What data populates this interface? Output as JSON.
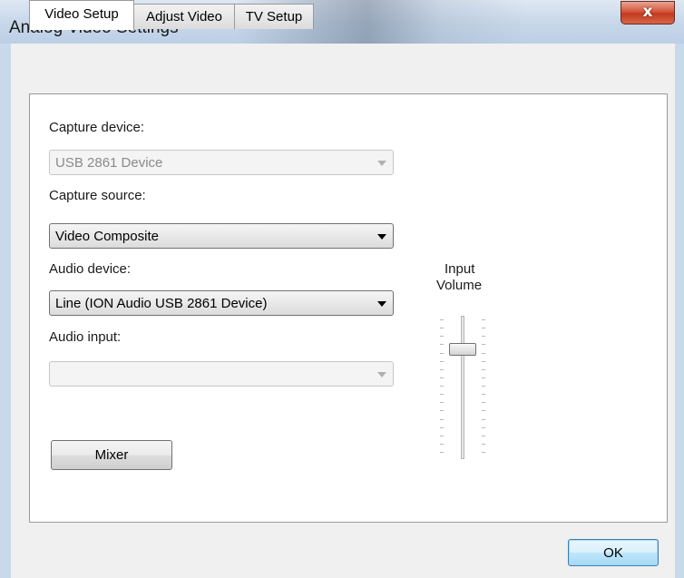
{
  "window": {
    "title": "Analog Video Settings",
    "close_label": "x"
  },
  "tabs": [
    {
      "label": "Video Setup",
      "active": true
    },
    {
      "label": "Adjust Video",
      "active": false
    },
    {
      "label": "TV Setup",
      "active": false
    }
  ],
  "video_setup": {
    "capture_device": {
      "label": "Capture device:",
      "value": "USB 2861 Device",
      "enabled": false
    },
    "capture_source": {
      "label": "Capture source:",
      "value": "Video Composite",
      "enabled": true
    },
    "audio_device": {
      "label": "Audio device:",
      "value": "Line (ION Audio USB 2861 Device)",
      "enabled": true
    },
    "audio_input": {
      "label": "Audio input:",
      "value": "",
      "enabled": false
    },
    "mixer_label": "Mixer",
    "volume": {
      "label_line1": "Input",
      "label_line2": "Volume",
      "level_fraction": 0.8
    }
  },
  "footer": {
    "ok_label": "OK"
  },
  "colors": {
    "title_bar": "#c8d8ea",
    "close_button": "#c9462b",
    "ok_button": "#bee6fd"
  }
}
